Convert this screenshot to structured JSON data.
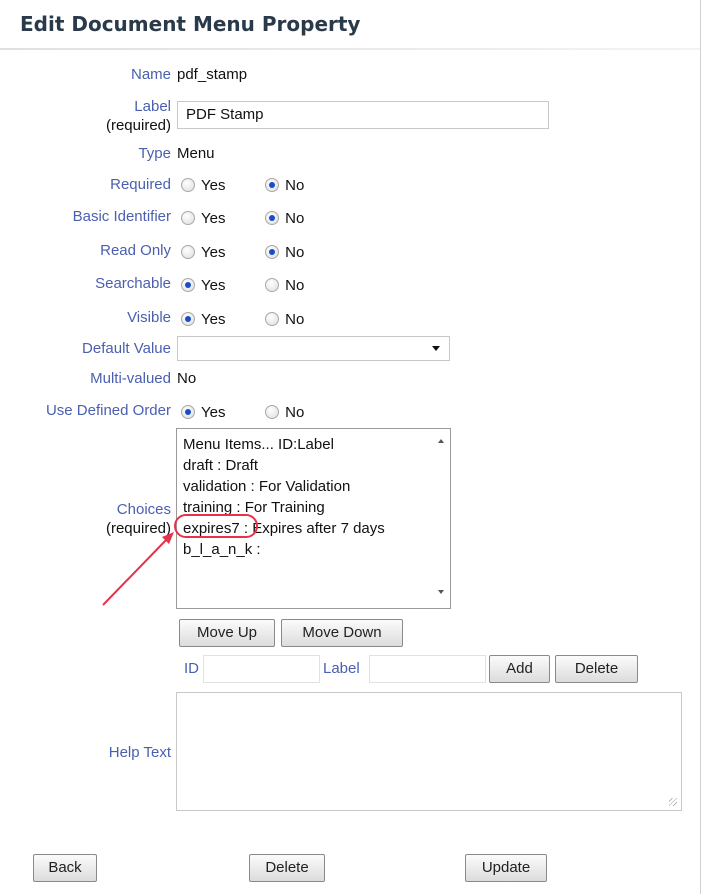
{
  "page": {
    "title": "Edit Document Menu Property"
  },
  "fields": {
    "name": {
      "label": "Name",
      "value": "pdf_stamp"
    },
    "label": {
      "label": "Label",
      "required": "(required)",
      "value": "PDF Stamp"
    },
    "type": {
      "label": "Type",
      "value": "Menu"
    },
    "required": {
      "label": "Required",
      "yes": "Yes",
      "no": "No",
      "selected": "No"
    },
    "basic_identifier": {
      "label": "Basic Identifier",
      "yes": "Yes",
      "no": "No",
      "selected": "No"
    },
    "read_only": {
      "label": "Read Only",
      "yes": "Yes",
      "no": "No",
      "selected": "No"
    },
    "searchable": {
      "label": "Searchable",
      "yes": "Yes",
      "no": "No",
      "selected": "Yes"
    },
    "visible": {
      "label": "Visible",
      "yes": "Yes",
      "no": "No",
      "selected": "Yes"
    },
    "default_value": {
      "label": "Default Value",
      "value": ""
    },
    "multi_valued": {
      "label": "Multi-valued",
      "value": "No"
    },
    "use_defined_order": {
      "label": "Use Defined Order",
      "yes": "Yes",
      "no": "No",
      "selected": "Yes"
    },
    "choices": {
      "label": "Choices",
      "required": "(required)",
      "items": [
        "Menu Items... ID:Label",
        "draft : Draft",
        "validation : For Validation",
        "training : For Training",
        "expires7 : Expires after 7 days",
        "b_l_a_n_k :"
      ],
      "highlighted_item": "expires7"
    },
    "help_text": {
      "label": "Help Text",
      "value": ""
    }
  },
  "choice_buttons": {
    "move_up": "Move Up",
    "move_down": "Move Down"
  },
  "add_row": {
    "id_label": "ID",
    "id_value": "",
    "label_label": "Label",
    "label_value": "",
    "add": "Add",
    "delete": "Delete"
  },
  "footer": {
    "back": "Back",
    "delete": "Delete",
    "update": "Update"
  },
  "colors": {
    "label_blue": "#4a5fb0",
    "annotation_red": "#e8324a",
    "radio_selected": "#1a4cc8"
  }
}
